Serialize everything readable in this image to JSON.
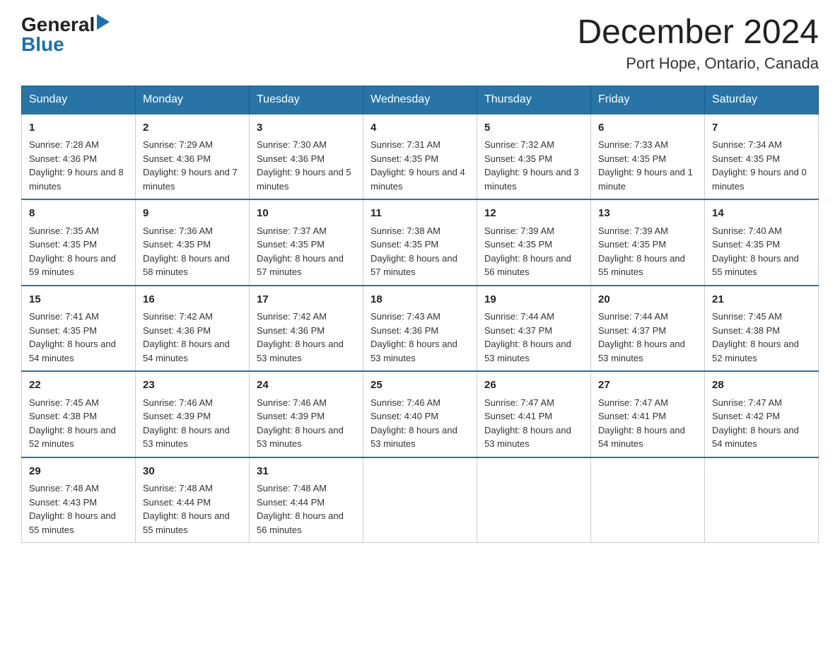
{
  "logo": {
    "general": "General",
    "triangle": "▶",
    "blue": "Blue"
  },
  "title": "December 2024",
  "subtitle": "Port Hope, Ontario, Canada",
  "days_of_week": [
    "Sunday",
    "Monday",
    "Tuesday",
    "Wednesday",
    "Thursday",
    "Friday",
    "Saturday"
  ],
  "weeks": [
    [
      {
        "day": "1",
        "sunrise": "7:28 AM",
        "sunset": "4:36 PM",
        "daylight": "9 hours and 8 minutes."
      },
      {
        "day": "2",
        "sunrise": "7:29 AM",
        "sunset": "4:36 PM",
        "daylight": "9 hours and 7 minutes."
      },
      {
        "day": "3",
        "sunrise": "7:30 AM",
        "sunset": "4:36 PM",
        "daylight": "9 hours and 5 minutes."
      },
      {
        "day": "4",
        "sunrise": "7:31 AM",
        "sunset": "4:35 PM",
        "daylight": "9 hours and 4 minutes."
      },
      {
        "day": "5",
        "sunrise": "7:32 AM",
        "sunset": "4:35 PM",
        "daylight": "9 hours and 3 minutes."
      },
      {
        "day": "6",
        "sunrise": "7:33 AM",
        "sunset": "4:35 PM",
        "daylight": "9 hours and 1 minute."
      },
      {
        "day": "7",
        "sunrise": "7:34 AM",
        "sunset": "4:35 PM",
        "daylight": "9 hours and 0 minutes."
      }
    ],
    [
      {
        "day": "8",
        "sunrise": "7:35 AM",
        "sunset": "4:35 PM",
        "daylight": "8 hours and 59 minutes."
      },
      {
        "day": "9",
        "sunrise": "7:36 AM",
        "sunset": "4:35 PM",
        "daylight": "8 hours and 58 minutes."
      },
      {
        "day": "10",
        "sunrise": "7:37 AM",
        "sunset": "4:35 PM",
        "daylight": "8 hours and 57 minutes."
      },
      {
        "day": "11",
        "sunrise": "7:38 AM",
        "sunset": "4:35 PM",
        "daylight": "8 hours and 57 minutes."
      },
      {
        "day": "12",
        "sunrise": "7:39 AM",
        "sunset": "4:35 PM",
        "daylight": "8 hours and 56 minutes."
      },
      {
        "day": "13",
        "sunrise": "7:39 AM",
        "sunset": "4:35 PM",
        "daylight": "8 hours and 55 minutes."
      },
      {
        "day": "14",
        "sunrise": "7:40 AM",
        "sunset": "4:35 PM",
        "daylight": "8 hours and 55 minutes."
      }
    ],
    [
      {
        "day": "15",
        "sunrise": "7:41 AM",
        "sunset": "4:35 PM",
        "daylight": "8 hours and 54 minutes."
      },
      {
        "day": "16",
        "sunrise": "7:42 AM",
        "sunset": "4:36 PM",
        "daylight": "8 hours and 54 minutes."
      },
      {
        "day": "17",
        "sunrise": "7:42 AM",
        "sunset": "4:36 PM",
        "daylight": "8 hours and 53 minutes."
      },
      {
        "day": "18",
        "sunrise": "7:43 AM",
        "sunset": "4:36 PM",
        "daylight": "8 hours and 53 minutes."
      },
      {
        "day": "19",
        "sunrise": "7:44 AM",
        "sunset": "4:37 PM",
        "daylight": "8 hours and 53 minutes."
      },
      {
        "day": "20",
        "sunrise": "7:44 AM",
        "sunset": "4:37 PM",
        "daylight": "8 hours and 53 minutes."
      },
      {
        "day": "21",
        "sunrise": "7:45 AM",
        "sunset": "4:38 PM",
        "daylight": "8 hours and 52 minutes."
      }
    ],
    [
      {
        "day": "22",
        "sunrise": "7:45 AM",
        "sunset": "4:38 PM",
        "daylight": "8 hours and 52 minutes."
      },
      {
        "day": "23",
        "sunrise": "7:46 AM",
        "sunset": "4:39 PM",
        "daylight": "8 hours and 53 minutes."
      },
      {
        "day": "24",
        "sunrise": "7:46 AM",
        "sunset": "4:39 PM",
        "daylight": "8 hours and 53 minutes."
      },
      {
        "day": "25",
        "sunrise": "7:46 AM",
        "sunset": "4:40 PM",
        "daylight": "8 hours and 53 minutes."
      },
      {
        "day": "26",
        "sunrise": "7:47 AM",
        "sunset": "4:41 PM",
        "daylight": "8 hours and 53 minutes."
      },
      {
        "day": "27",
        "sunrise": "7:47 AM",
        "sunset": "4:41 PM",
        "daylight": "8 hours and 54 minutes."
      },
      {
        "day": "28",
        "sunrise": "7:47 AM",
        "sunset": "4:42 PM",
        "daylight": "8 hours and 54 minutes."
      }
    ],
    [
      {
        "day": "29",
        "sunrise": "7:48 AM",
        "sunset": "4:43 PM",
        "daylight": "8 hours and 55 minutes."
      },
      {
        "day": "30",
        "sunrise": "7:48 AM",
        "sunset": "4:44 PM",
        "daylight": "8 hours and 55 minutes."
      },
      {
        "day": "31",
        "sunrise": "7:48 AM",
        "sunset": "4:44 PM",
        "daylight": "8 hours and 56 minutes."
      },
      null,
      null,
      null,
      null
    ]
  ],
  "labels": {
    "sunrise": "Sunrise:",
    "sunset": "Sunset:",
    "daylight": "Daylight:"
  }
}
